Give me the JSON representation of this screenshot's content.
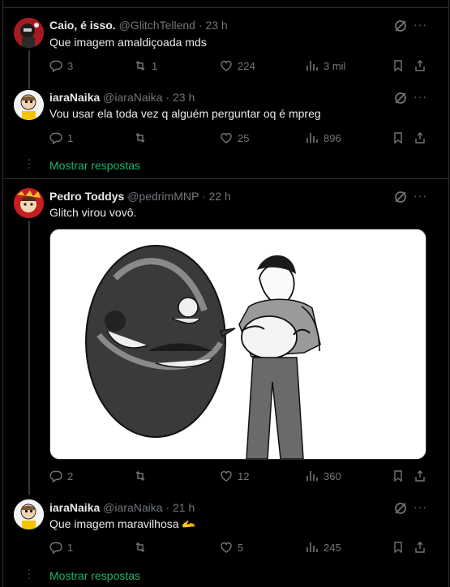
{
  "replies": [
    {
      "name": "Caio, é isso.",
      "handle": "@GlitchTellend",
      "time": "23 h",
      "text": "Que imagem amaldiçoada mds",
      "stats": {
        "replies": "3",
        "reposts": "1",
        "likes": "224",
        "views": "3 mil"
      }
    },
    {
      "name": "iaraNaika",
      "handle": "@iaraNaika",
      "time": "23 h",
      "text": "Vou usar ela toda vez q alguém perguntar oq é mpreg",
      "stats": {
        "replies": "1",
        "reposts": "",
        "likes": "25",
        "views": "896"
      }
    },
    {
      "name": "Pedro Toddys",
      "handle": "@pedrimMNP",
      "time": "22 h",
      "text": "Glitch virou vovô.",
      "stats": {
        "replies": "2",
        "reposts": "",
        "likes": "12",
        "views": "360"
      }
    },
    {
      "name": "iaraNaika",
      "handle": "@iaraNaika",
      "time": "21 h",
      "text": "Que imagem maravilhosa",
      "emoji": "🫴",
      "stats": {
        "replies": "1",
        "reposts": "",
        "likes": "5",
        "views": "245"
      }
    }
  ],
  "show_replies_label": "Mostrar respostas",
  "separator": "·",
  "more_glyph": "···",
  "icons": {
    "reply": "reply-icon",
    "repost": "repost-icon",
    "like": "like-icon",
    "views": "views-icon",
    "bookmark": "bookmark-icon",
    "share": "share-icon",
    "grok": "grok-icon"
  },
  "colors": {
    "background": "#000000",
    "text": "#e7e9ea",
    "muted": "#71767b",
    "link": "#1cb56b",
    "border": "#2f3336"
  }
}
